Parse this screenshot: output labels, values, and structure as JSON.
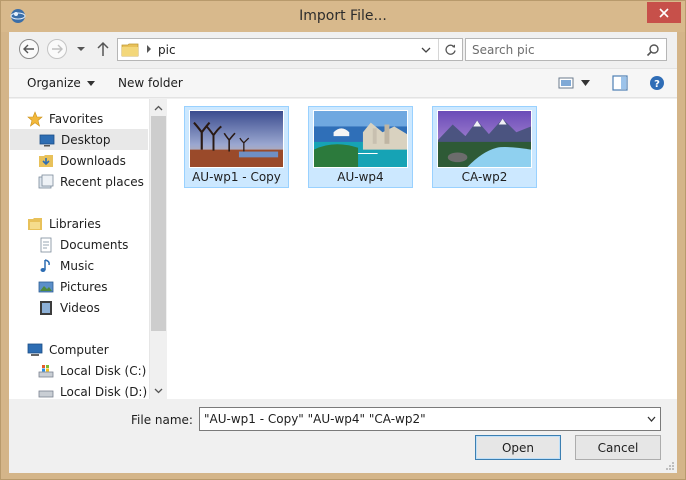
{
  "window": {
    "title": "Import File..."
  },
  "address": {
    "path": "pic"
  },
  "search": {
    "placeholder": "Search pic"
  },
  "toolbar": {
    "organize": "Organize",
    "new_folder": "New folder"
  },
  "nav": {
    "favorites": "Favorites",
    "desktop": "Desktop",
    "downloads": "Downloads",
    "recent": "Recent places",
    "libraries": "Libraries",
    "documents": "Documents",
    "music": "Music",
    "pictures": "Pictures",
    "videos": "Videos",
    "computer": "Computer",
    "disk_c": "Local Disk (C:)",
    "disk_d": "Local Disk (D:)"
  },
  "files": [
    {
      "name": "AU-wp1 - Copy"
    },
    {
      "name": "AU-wp4"
    },
    {
      "name": "CA-wp2"
    }
  ],
  "footer": {
    "filename_label": "File name:",
    "filename_value": "\"AU-wp1 - Copy\" \"AU-wp4\" \"CA-wp2\"",
    "open": "Open",
    "cancel": "Cancel"
  }
}
